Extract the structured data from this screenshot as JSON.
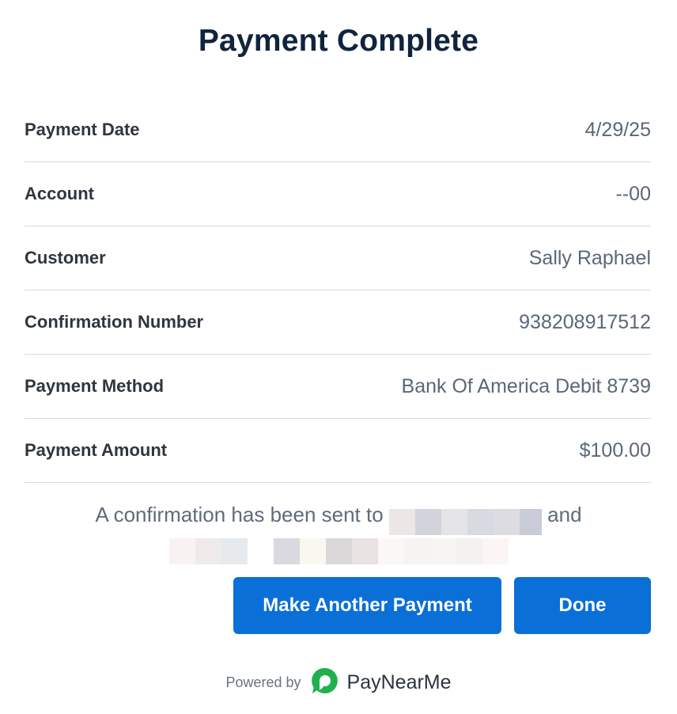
{
  "header": {
    "title": "Payment Complete"
  },
  "details": [
    {
      "label": "Payment Date",
      "value": "4/29/25"
    },
    {
      "label": "Account",
      "value": "--00"
    },
    {
      "label": "Customer",
      "value": "Sally Raphael"
    },
    {
      "label": "Confirmation Number",
      "value": "938208917512"
    },
    {
      "label": "Payment Method",
      "value": "Bank Of America Debit 8739"
    },
    {
      "label": "Payment Amount",
      "value": "$100.00"
    }
  ],
  "confirmation": {
    "prefix": "A confirmation has been sent to",
    "connector": "and"
  },
  "actions": {
    "make_another_label": "Make Another Payment",
    "done_label": "Done"
  },
  "footer": {
    "powered_by": "Powered by",
    "brand": "PayNearMe"
  },
  "colors": {
    "accent": "#0b6fd8",
    "title": "#10243e",
    "brand_green": "#1fb14d"
  }
}
